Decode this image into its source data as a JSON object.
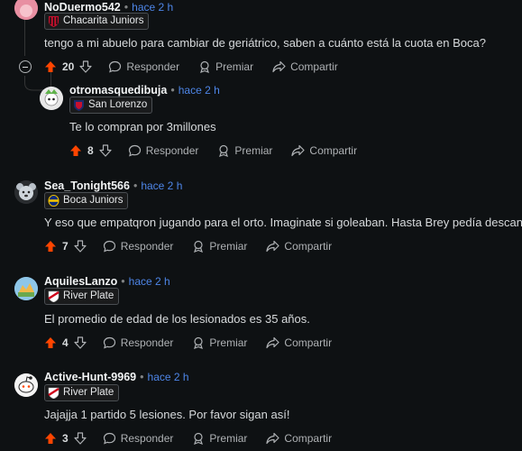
{
  "ui": {
    "upvote_color": "#ff4500",
    "time_color": "#4e86e8"
  },
  "comments": [
    {
      "username": "NoDuermo542",
      "time": "hace 2 h",
      "flair": "Chacarita Juniors",
      "text": "tengo a mi abuelo para cambiar de geriátrico, saben a cuánto está la cuota en Boca?",
      "votes": "20",
      "reply": "Responder",
      "award": "Premiar",
      "share": "Compartir"
    },
    {
      "username": "otromasquedibuja",
      "time": "hace 2 h",
      "flair": "San Lorenzo",
      "text": "Te lo compran por 3millones",
      "votes": "8",
      "reply": "Responder",
      "award": "Premiar",
      "share": "Compartir"
    },
    {
      "username": "Sea_Tonight566",
      "time": "hace 2 h",
      "flair": "Boca Juniors",
      "text": "Y eso que empatqron jugando para el orto. Imaginate si goleaban. Hasta Brey pedía descanso",
      "votes": "7",
      "reply": "Responder",
      "award": "Premiar",
      "share": "Compartir"
    },
    {
      "username": "AquilesLanzo",
      "time": "hace 2 h",
      "flair": "River Plate",
      "text": "El promedio de edad de los lesionados es 35 años.",
      "votes": "4",
      "reply": "Responder",
      "award": "Premiar",
      "share": "Compartir"
    },
    {
      "username": "Active-Hunt-9969",
      "time": "hace 2 h",
      "flair": "River Plate",
      "text": "Jajajja 1 partido 5 lesiones. Por favor sigan así!",
      "votes": "3",
      "reply": "Responder",
      "award": "Premiar",
      "share": "Compartir"
    }
  ]
}
